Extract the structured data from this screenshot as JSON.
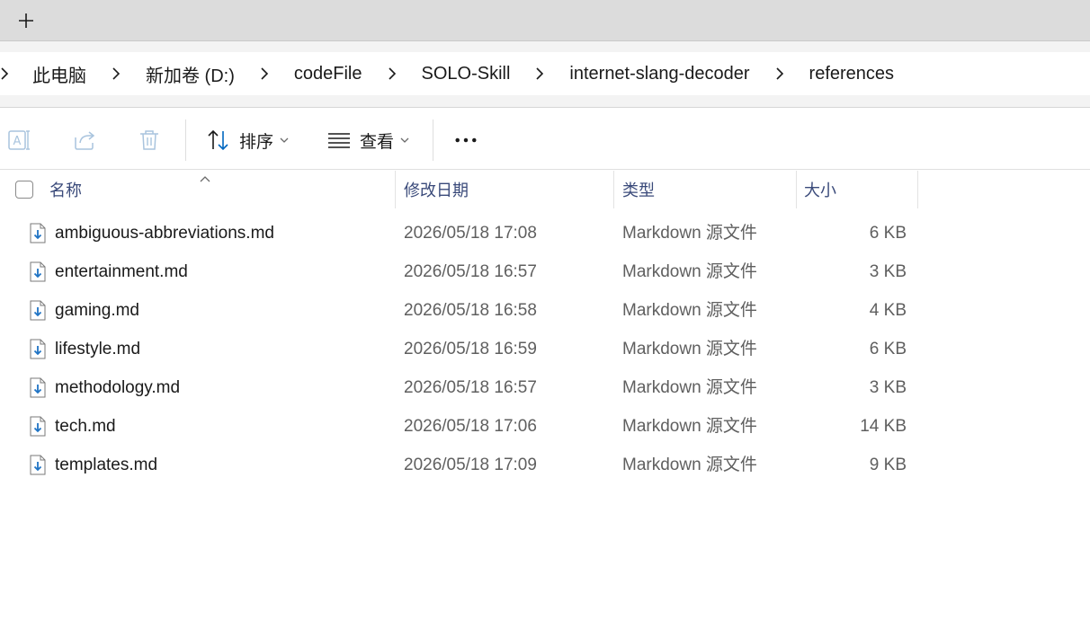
{
  "tabstrip": {
    "new_tab_icon": "plus-icon"
  },
  "breadcrumb": {
    "items": [
      "此电脑",
      "新加卷 (D:)",
      "codeFile",
      "SOLO-Skill",
      "internet-slang-decoder",
      "references"
    ],
    "separator_icon": "chevron-right-icon"
  },
  "commandbar": {
    "rename_icon": "rename-icon",
    "share_icon": "share-icon",
    "delete_icon": "trash-icon",
    "sort_label": "排序",
    "view_label": "查看",
    "more_icon": "more-icon"
  },
  "columns": {
    "name": "名称",
    "modified": "修改日期",
    "type": "类型",
    "size": "大小"
  },
  "files": [
    {
      "name": "ambiguous-abbreviations.md",
      "modified": "2026/05/18 17:08",
      "type": "Markdown 源文件",
      "size": "6 KB"
    },
    {
      "name": "entertainment.md",
      "modified": "2026/05/18 16:57",
      "type": "Markdown 源文件",
      "size": "3 KB"
    },
    {
      "name": "gaming.md",
      "modified": "2026/05/18 16:58",
      "type": "Markdown 源文件",
      "size": "4 KB"
    },
    {
      "name": "lifestyle.md",
      "modified": "2026/05/18 16:59",
      "type": "Markdown 源文件",
      "size": "6 KB"
    },
    {
      "name": "methodology.md",
      "modified": "2026/05/18 16:57",
      "type": "Markdown 源文件",
      "size": "3 KB"
    },
    {
      "name": "tech.md",
      "modified": "2026/05/18 17:06",
      "type": "Markdown 源文件",
      "size": "14 KB"
    },
    {
      "name": "templates.md",
      "modified": "2026/05/18 17:09",
      "type": "Markdown 源文件",
      "size": "9 KB"
    }
  ],
  "colors": {
    "accent": "#0067c0",
    "header_text": "#3a4a7a",
    "disabled_icon": "#a9c4de"
  }
}
